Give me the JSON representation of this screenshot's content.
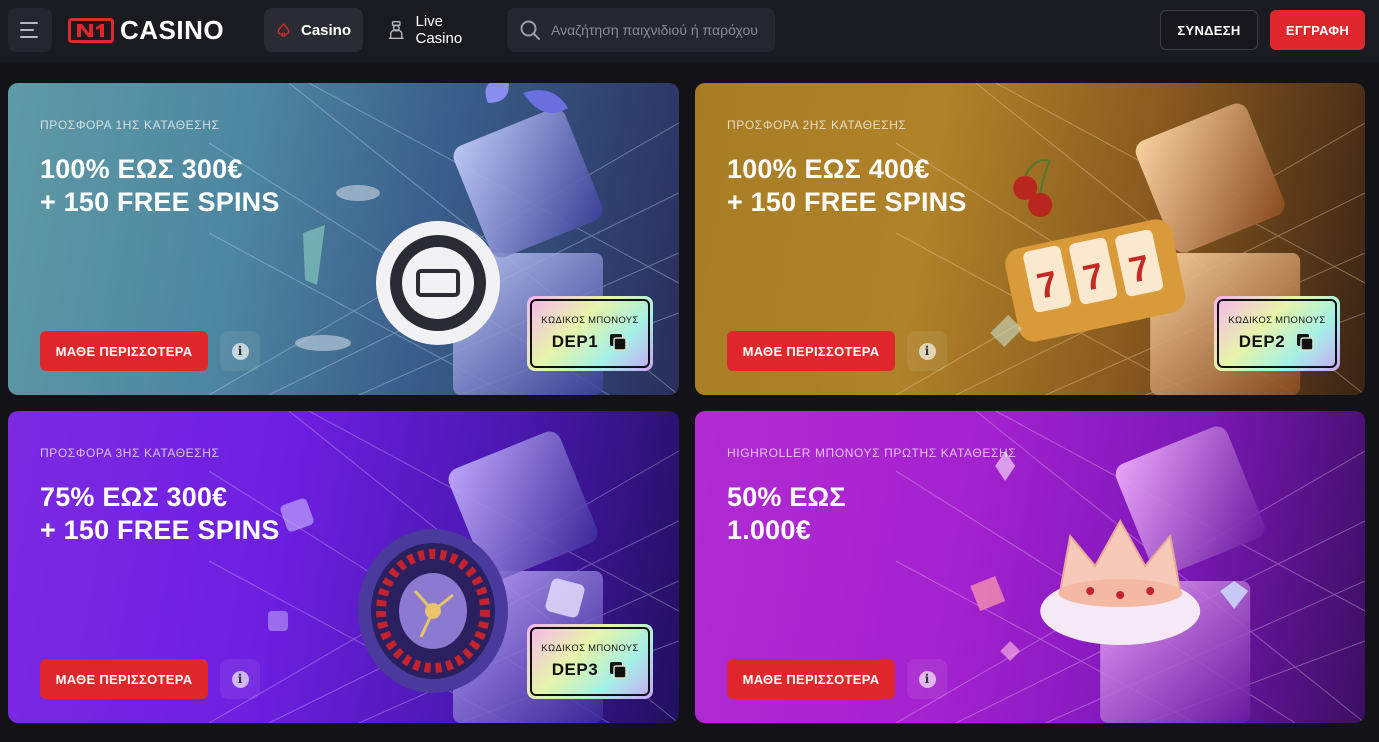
{
  "header": {
    "logo_text": "CASINO",
    "nav": [
      {
        "label": "Casino",
        "icon": "spade-icon",
        "active": true
      },
      {
        "label": "Live Casino",
        "icon": "dealer-icon",
        "active": false
      }
    ],
    "search": {
      "placeholder": "Αναζήτηση παιχνιδιού ή παρόχου"
    },
    "login_label": "ΣΥΝΔΕΣΗ",
    "register_label": "ΕΓΓΡΑΦΗ"
  },
  "promos": [
    {
      "eyebrow": "ΠΡΟΣΦΟΡΑ 1ΗΣ ΚΑΤΑΘΕΣΗΣ",
      "title": "100% ΕΩΣ 300€\n+ 150 FREE SPINS",
      "button": "ΜΑΘΕ ΠΕΡΙΣΣΟΤΕΡΑ",
      "code_label": "ΚΩΔΙΚΟΣ ΜΠΟΝΟΥΣ",
      "code": "DEP1",
      "art": "gift-chip"
    },
    {
      "eyebrow": "ΠΡΟΣΦΟΡΑ 2ΗΣ ΚΑΤΑΘΕΣΗΣ",
      "title": "100% ΕΩΣ 400€\n+ 150 FREE SPINS",
      "button": "ΜΑΘΕ ΠΕΡΙΣΣΟΤΕΡΑ",
      "code_label": "ΚΩΔΙΚΟΣ ΜΠΟΝΟΥΣ",
      "code": "DEP2",
      "art": "gift-slot"
    },
    {
      "eyebrow": "ΠΡΟΣΦΟΡΑ 3ΗΣ ΚΑΤΑΘΕΣΗΣ",
      "title": "75% ΕΩΣ 300€\n+ 150 FREE SPINS",
      "button": "ΜΑΘΕ ΠΕΡΙΣΣΟΤΕΡΑ",
      "code_label": "ΚΩΔΙΚΟΣ ΜΠΟΝΟΥΣ",
      "code": "DEP3",
      "art": "gift-roulette"
    },
    {
      "eyebrow": "HIGHROLLER ΜΠΟΝΟΥΣ ΠΡΩΤΗΣ ΚΑΤΑΘΕΣΗΣ",
      "title": "50% ΕΩΣ\n1.000€",
      "button": "ΜΑΘΕ ΠΕΡΙΣΣΟΤΕΡΑ",
      "art": "gift-crown"
    }
  ],
  "colors": {
    "accent": "#e0282c",
    "header_bg": "#1a1a21",
    "page_bg": "#121217"
  }
}
